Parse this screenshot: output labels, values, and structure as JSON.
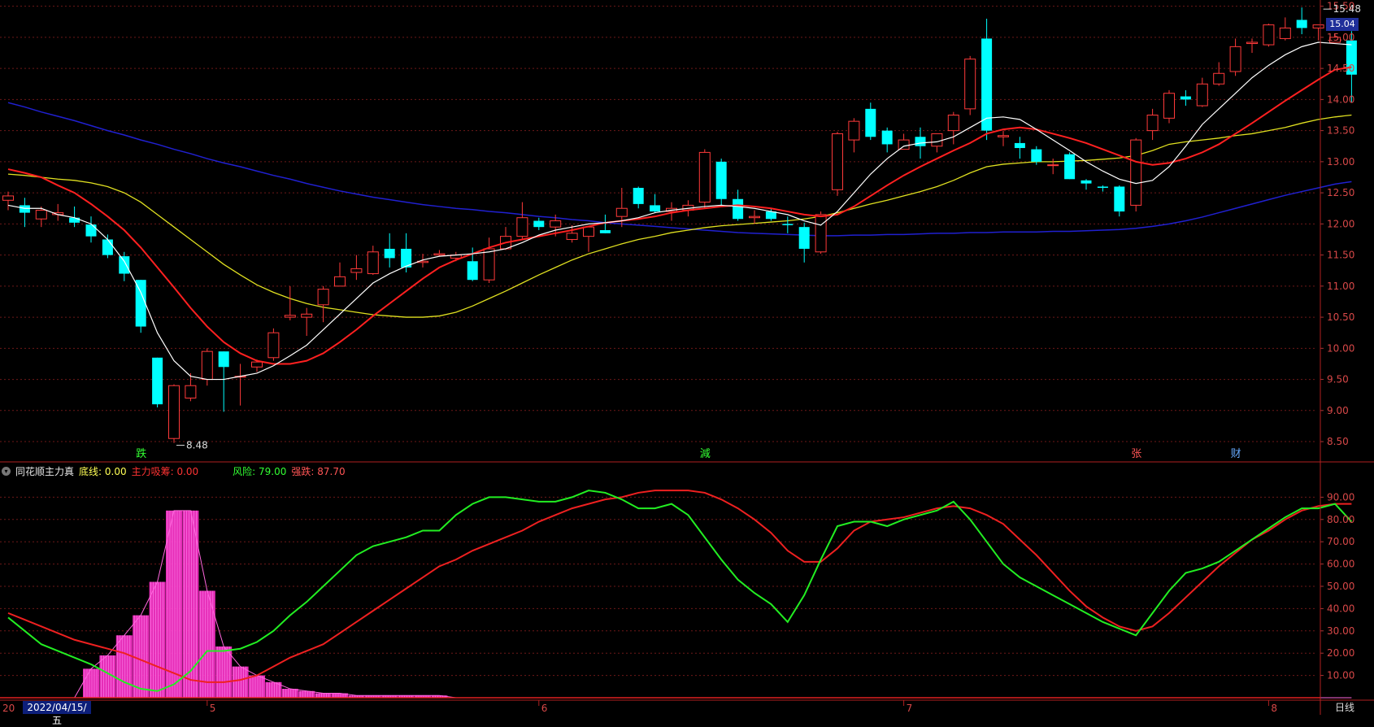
{
  "main": {
    "y_ticks": [
      "15.50",
      "15.00",
      "14.50",
      "14.00",
      "13.50",
      "13.00",
      "12.50",
      "12.00",
      "11.50",
      "11.00",
      "10.50",
      "10.00",
      "9.50",
      "9.00",
      "8.50"
    ],
    "current_price": "15.04",
    "high_label": "15.48",
    "low_label": "8.48",
    "markers": [
      {
        "label": "跌",
        "color": "#33ff33"
      },
      {
        "label": "減",
        "color": "#33ff33"
      },
      {
        "label": "张",
        "color": "#ff5555"
      },
      {
        "label": "财",
        "color": "#66aaff"
      }
    ]
  },
  "indicator": {
    "collapse_icon": "chevron-down-icon",
    "title": "同花顺主力真",
    "base_line": "底线: 0.00",
    "main_absorb": "主力吸筹: 0.00",
    "risk": "风险: 79.00",
    "rise_fall": "强跌: 87.70",
    "y_ticks": [
      "90.00",
      "80.00",
      "70.00",
      "60.00",
      "50.00",
      "40.00",
      "30.00",
      "20.00",
      "10.00"
    ]
  },
  "x_axis": {
    "date_label": "2022/04/15/五",
    "prefix": "20",
    "month_ticks": [
      "5",
      "6",
      "7",
      "8"
    ]
  },
  "period_button": "日线",
  "colors": {
    "up": "#ff3a3a",
    "down": "#00ffff",
    "ma5": "#ffffff",
    "ma10": "#ff2020",
    "ma20": "#e0e020",
    "ma60": "#2020d0",
    "risk_line": "#22ee22",
    "rise_line": "#ee2020",
    "hist": "#ff33cc",
    "grid": "#6e1818"
  },
  "chart_data": [
    {
      "type": "candlestick",
      "ylim": [
        8.2,
        15.6
      ],
      "candles": [
        [
          12.38,
          12.52,
          12.22,
          12.45
        ],
        [
          12.3,
          12.42,
          11.95,
          12.18
        ],
        [
          12.08,
          12.28,
          11.95,
          12.22
        ],
        [
          12.15,
          12.32,
          12.05,
          12.18
        ],
        [
          12.1,
          12.28,
          11.95,
          12.02
        ],
        [
          11.99,
          12.12,
          11.7,
          11.8
        ],
        [
          11.75,
          11.83,
          11.45,
          11.5
        ],
        [
          11.48,
          11.55,
          11.08,
          11.2
        ],
        [
          11.1,
          11.1,
          10.25,
          10.35
        ],
        [
          9.85,
          9.85,
          9.05,
          9.1
        ],
        [
          8.55,
          9.42,
          8.48,
          9.4
        ],
        [
          9.2,
          9.6,
          9.15,
          9.4
        ],
        [
          9.5,
          10.0,
          9.4,
          9.95
        ],
        [
          9.95,
          9.95,
          8.98,
          9.7
        ],
        [
          9.55,
          9.75,
          9.08,
          9.55
        ],
        [
          9.7,
          9.82,
          9.62,
          9.78
        ],
        [
          9.85,
          10.32,
          9.8,
          10.25
        ],
        [
          10.5,
          11.0,
          10.45,
          10.53
        ],
        [
          10.5,
          10.65,
          10.2,
          10.55
        ],
        [
          10.7,
          11.0,
          10.42,
          10.95
        ],
        [
          11.0,
          11.38,
          11.0,
          11.15
        ],
        [
          11.22,
          11.5,
          11.1,
          11.28
        ],
        [
          11.2,
          11.65,
          11.18,
          11.55
        ],
        [
          11.6,
          11.85,
          11.3,
          11.45
        ],
        [
          11.6,
          11.85,
          11.22,
          11.3
        ],
        [
          11.38,
          11.52,
          11.3,
          11.4
        ],
        [
          11.5,
          11.58,
          11.48,
          11.52
        ],
        [
          11.45,
          11.55,
          11.4,
          11.5
        ],
        [
          11.4,
          11.62,
          11.08,
          11.1
        ],
        [
          11.1,
          11.78,
          11.05,
          11.6
        ],
        [
          11.6,
          11.95,
          11.58,
          11.8
        ],
        [
          11.8,
          12.35,
          11.75,
          12.1
        ],
        [
          12.05,
          12.1,
          11.9,
          11.95
        ],
        [
          11.95,
          12.15,
          11.8,
          12.05
        ],
        [
          11.75,
          11.98,
          11.7,
          11.85
        ],
        [
          11.8,
          11.95,
          11.55,
          11.95
        ],
        [
          11.9,
          12.15,
          11.85,
          11.85
        ],
        [
          12.12,
          12.58,
          11.95,
          12.25
        ],
        [
          12.58,
          12.6,
          12.25,
          12.32
        ],
        [
          12.3,
          12.48,
          12.18,
          12.2
        ],
        [
          12.2,
          12.35,
          12.05,
          12.25
        ],
        [
          12.22,
          12.38,
          12.12,
          12.3
        ],
        [
          12.35,
          13.2,
          12.25,
          13.15
        ],
        [
          13.0,
          13.05,
          12.3,
          12.4
        ],
        [
          12.4,
          12.55,
          12.05,
          12.08
        ],
        [
          12.1,
          12.22,
          12.0,
          12.12
        ],
        [
          12.2,
          12.25,
          12.05,
          12.08
        ],
        [
          12.0,
          12.12,
          11.85,
          11.98
        ],
        [
          11.95,
          12.02,
          11.38,
          11.6
        ],
        [
          11.55,
          12.2,
          11.52,
          12.15
        ],
        [
          12.55,
          13.48,
          12.45,
          13.45
        ],
        [
          13.35,
          13.7,
          13.15,
          13.65
        ],
        [
          13.85,
          13.95,
          13.35,
          13.4
        ],
        [
          13.5,
          13.55,
          13.15,
          13.28
        ],
        [
          13.2,
          13.45,
          13.2,
          13.35
        ],
        [
          13.4,
          13.55,
          13.05,
          13.25
        ],
        [
          13.25,
          13.45,
          13.15,
          13.45
        ],
        [
          13.5,
          13.8,
          13.28,
          13.75
        ],
        [
          13.85,
          14.7,
          13.75,
          14.65
        ],
        [
          14.98,
          15.3,
          13.35,
          13.5
        ],
        [
          13.4,
          13.5,
          13.25,
          13.42
        ],
        [
          13.3,
          13.4,
          13.05,
          13.22
        ],
        [
          13.2,
          13.25,
          12.95,
          13.0
        ],
        [
          12.95,
          13.05,
          12.8,
          12.95
        ],
        [
          13.12,
          13.15,
          12.72,
          12.72
        ],
        [
          12.7,
          12.72,
          12.55,
          12.65
        ],
        [
          12.6,
          12.62,
          12.52,
          12.58
        ],
        [
          12.6,
          12.62,
          12.12,
          12.2
        ],
        [
          12.3,
          13.38,
          12.2,
          13.35
        ],
        [
          13.5,
          13.85,
          13.35,
          13.75
        ],
        [
          13.7,
          14.15,
          13.62,
          14.1
        ],
        [
          14.05,
          14.15,
          13.9,
          14.0
        ],
        [
          13.9,
          14.35,
          13.88,
          14.25
        ],
        [
          14.25,
          14.6,
          14.22,
          14.42
        ],
        [
          14.45,
          14.98,
          14.38,
          14.85
        ],
        [
          14.9,
          14.98,
          14.75,
          14.92
        ],
        [
          14.88,
          15.22,
          14.85,
          15.2
        ],
        [
          14.98,
          15.32,
          14.95,
          15.15
        ],
        [
          15.28,
          15.48,
          15.05,
          15.15
        ],
        [
          15.15,
          15.2,
          14.95,
          15.2
        ],
        [
          14.92,
          15.05,
          14.95,
          15.0
        ],
        [
          14.95,
          15.1,
          13.95,
          14.4
        ]
      ],
      "ma5": [
        12.3,
        12.25,
        12.25,
        12.15,
        12.1,
        12.0,
        11.75,
        11.4,
        10.9,
        10.25,
        9.8,
        9.55,
        9.5,
        9.5,
        9.55,
        9.6,
        9.72,
        9.88,
        10.05,
        10.3,
        10.55,
        10.8,
        11.05,
        11.2,
        11.32,
        11.42,
        11.48,
        11.5,
        11.52,
        11.55,
        11.6,
        11.7,
        11.82,
        11.9,
        11.95,
        12.0,
        12.02,
        12.05,
        12.1,
        12.18,
        12.22,
        12.25,
        12.28,
        12.3,
        12.28,
        12.25,
        12.2,
        12.15,
        12.05,
        11.98,
        12.2,
        12.5,
        12.8,
        13.05,
        13.25,
        13.3,
        13.32,
        13.4,
        13.55,
        13.7,
        13.72,
        13.68,
        13.52,
        13.35,
        13.18,
        13.0,
        12.85,
        12.72,
        12.65,
        12.7,
        12.92,
        13.25,
        13.6,
        13.85,
        14.1,
        14.35,
        14.55,
        14.72,
        14.85,
        14.92,
        14.9,
        14.88
      ],
      "ma10": [
        12.88,
        12.82,
        12.75,
        12.62,
        12.5,
        12.32,
        12.12,
        11.9,
        11.62,
        11.3,
        10.98,
        10.65,
        10.35,
        10.1,
        9.92,
        9.8,
        9.75,
        9.75,
        9.8,
        9.92,
        10.1,
        10.3,
        10.52,
        10.72,
        10.92,
        11.12,
        11.3,
        11.42,
        11.52,
        11.62,
        11.7,
        11.75,
        11.8,
        11.85,
        11.9,
        11.96,
        12.02,
        12.05,
        12.08,
        12.12,
        12.18,
        12.22,
        12.25,
        12.28,
        12.3,
        12.28,
        12.25,
        12.2,
        12.15,
        12.12,
        12.15,
        12.28,
        12.45,
        12.62,
        12.78,
        12.92,
        13.05,
        13.18,
        13.3,
        13.45,
        13.52,
        13.55,
        13.52,
        13.45,
        13.38,
        13.3,
        13.2,
        13.1,
        13.0,
        12.95,
        12.98,
        13.05,
        13.15,
        13.28,
        13.45,
        13.62,
        13.8,
        13.98,
        14.15,
        14.32,
        14.48,
        14.52
      ],
      "ma20": [
        12.8,
        12.78,
        12.75,
        12.72,
        12.7,
        12.66,
        12.6,
        12.5,
        12.35,
        12.15,
        11.95,
        11.75,
        11.55,
        11.35,
        11.18,
        11.02,
        10.9,
        10.8,
        10.72,
        10.66,
        10.62,
        10.58,
        10.54,
        10.52,
        10.5,
        10.5,
        10.52,
        10.58,
        10.68,
        10.8,
        10.92,
        11.05,
        11.18,
        11.3,
        11.42,
        11.52,
        11.6,
        11.68,
        11.75,
        11.8,
        11.86,
        11.9,
        11.94,
        11.97,
        11.99,
        12.01,
        12.03,
        12.05,
        12.08,
        12.12,
        12.18,
        12.25,
        12.32,
        12.38,
        12.45,
        12.52,
        12.6,
        12.7,
        12.82,
        12.92,
        12.96,
        12.98,
        13.0,
        13.0,
        13.01,
        13.02,
        13.04,
        13.06,
        13.1,
        13.18,
        13.28,
        13.32,
        13.35,
        13.38,
        13.42,
        13.45,
        13.5,
        13.55,
        13.62,
        13.68,
        13.72,
        13.75
      ],
      "ma60": [
        13.95,
        13.88,
        13.8,
        13.73,
        13.66,
        13.58,
        13.5,
        13.43,
        13.35,
        13.28,
        13.2,
        13.13,
        13.05,
        12.98,
        12.92,
        12.85,
        12.78,
        12.72,
        12.65,
        12.59,
        12.53,
        12.48,
        12.43,
        12.39,
        12.35,
        12.31,
        12.28,
        12.25,
        12.23,
        12.2,
        12.18,
        12.15,
        12.12,
        12.1,
        12.07,
        12.05,
        12.02,
        12.0,
        11.98,
        11.96,
        11.94,
        11.92,
        11.9,
        11.88,
        11.86,
        11.85,
        11.84,
        11.83,
        11.82,
        11.81,
        11.81,
        11.82,
        11.82,
        11.83,
        11.83,
        11.84,
        11.85,
        11.85,
        11.86,
        11.86,
        11.87,
        11.87,
        11.87,
        11.88,
        11.88,
        11.89,
        11.9,
        11.91,
        11.93,
        11.96,
        12.0,
        12.05,
        12.11,
        12.18,
        12.25,
        12.32,
        12.39,
        12.46,
        12.52,
        12.58,
        12.64,
        12.68
      ]
    },
    {
      "type": "line",
      "ylim": [
        0,
        100
      ],
      "series": [
        {
          "name": "风险",
          "values": [
            36,
            30,
            24,
            21,
            18,
            15,
            11,
            7,
            4,
            3,
            6,
            12,
            21,
            21,
            22,
            25,
            30,
            37,
            43,
            50,
            57,
            64,
            68,
            70,
            72,
            75,
            75,
            82,
            87,
            90,
            90,
            89,
            88,
            88,
            90,
            93,
            92,
            89,
            85,
            85,
            87,
            82,
            72,
            62,
            53,
            47,
            42,
            34,
            46,
            62,
            77,
            79,
            79,
            77,
            80,
            82,
            84,
            88,
            80,
            70,
            60,
            54,
            50,
            46,
            42,
            38,
            34,
            31,
            28,
            38,
            48,
            56,
            58,
            61,
            66,
            71,
            76,
            81,
            85,
            85,
            87,
            79
          ]
        },
        {
          "name": "强跌",
          "values": [
            38,
            35,
            32,
            29,
            26,
            24,
            22,
            20,
            17,
            14,
            11,
            8,
            7,
            7,
            8,
            10,
            14,
            18,
            21,
            24,
            29,
            34,
            39,
            44,
            49,
            54,
            59,
            62,
            66,
            69,
            72,
            75,
            79,
            82,
            85,
            87,
            89,
            90,
            92,
            93,
            93,
            93,
            92,
            89,
            85,
            80,
            74,
            66,
            61,
            61,
            67,
            75,
            79,
            80,
            81,
            83,
            85,
            86,
            85,
            82,
            78,
            71,
            64,
            56,
            48,
            41,
            36,
            32,
            30,
            32,
            38,
            45,
            52,
            59,
            65,
            71,
            75,
            80,
            84,
            86,
            87,
            87
          ]
        },
        {
          "name": "主力吸筹",
          "values": [
            0,
            0,
            0,
            0,
            0,
            13,
            19,
            28,
            37,
            52,
            84,
            84,
            48,
            23,
            14,
            10,
            7,
            4,
            3,
            2,
            2,
            1,
            1,
            1,
            1,
            1,
            1,
            0,
            0,
            0,
            0,
            0,
            0,
            0,
            0,
            0,
            0,
            0,
            0,
            0,
            0,
            0,
            0,
            0,
            0,
            0,
            0,
            0,
            0,
            0,
            0,
            0,
            0,
            0,
            0,
            0,
            0,
            0,
            0,
            0,
            0,
            0,
            0,
            0,
            0,
            0,
            0,
            0,
            0,
            0,
            0,
            0,
            0,
            0,
            0,
            0,
            0,
            0,
            0,
            0,
            0,
            0
          ]
        }
      ]
    }
  ]
}
